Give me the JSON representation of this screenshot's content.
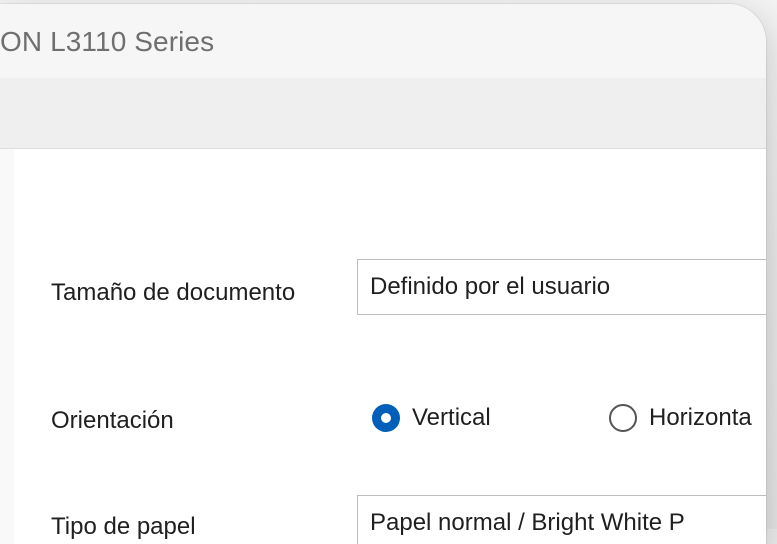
{
  "window": {
    "title": "ON L3110 Series"
  },
  "form": {
    "document_size": {
      "label": "Tamaño de documento",
      "value": "Definido por el usuario"
    },
    "orientation": {
      "label": "Orientación",
      "options": [
        {
          "label": "Vertical",
          "checked": true
        },
        {
          "label": "Horizonta",
          "checked": false
        }
      ]
    },
    "paper_type": {
      "label": "Tipo de papel",
      "value": "Papel normal / Bright White P"
    }
  },
  "colors": {
    "accent": "#005fb8"
  }
}
